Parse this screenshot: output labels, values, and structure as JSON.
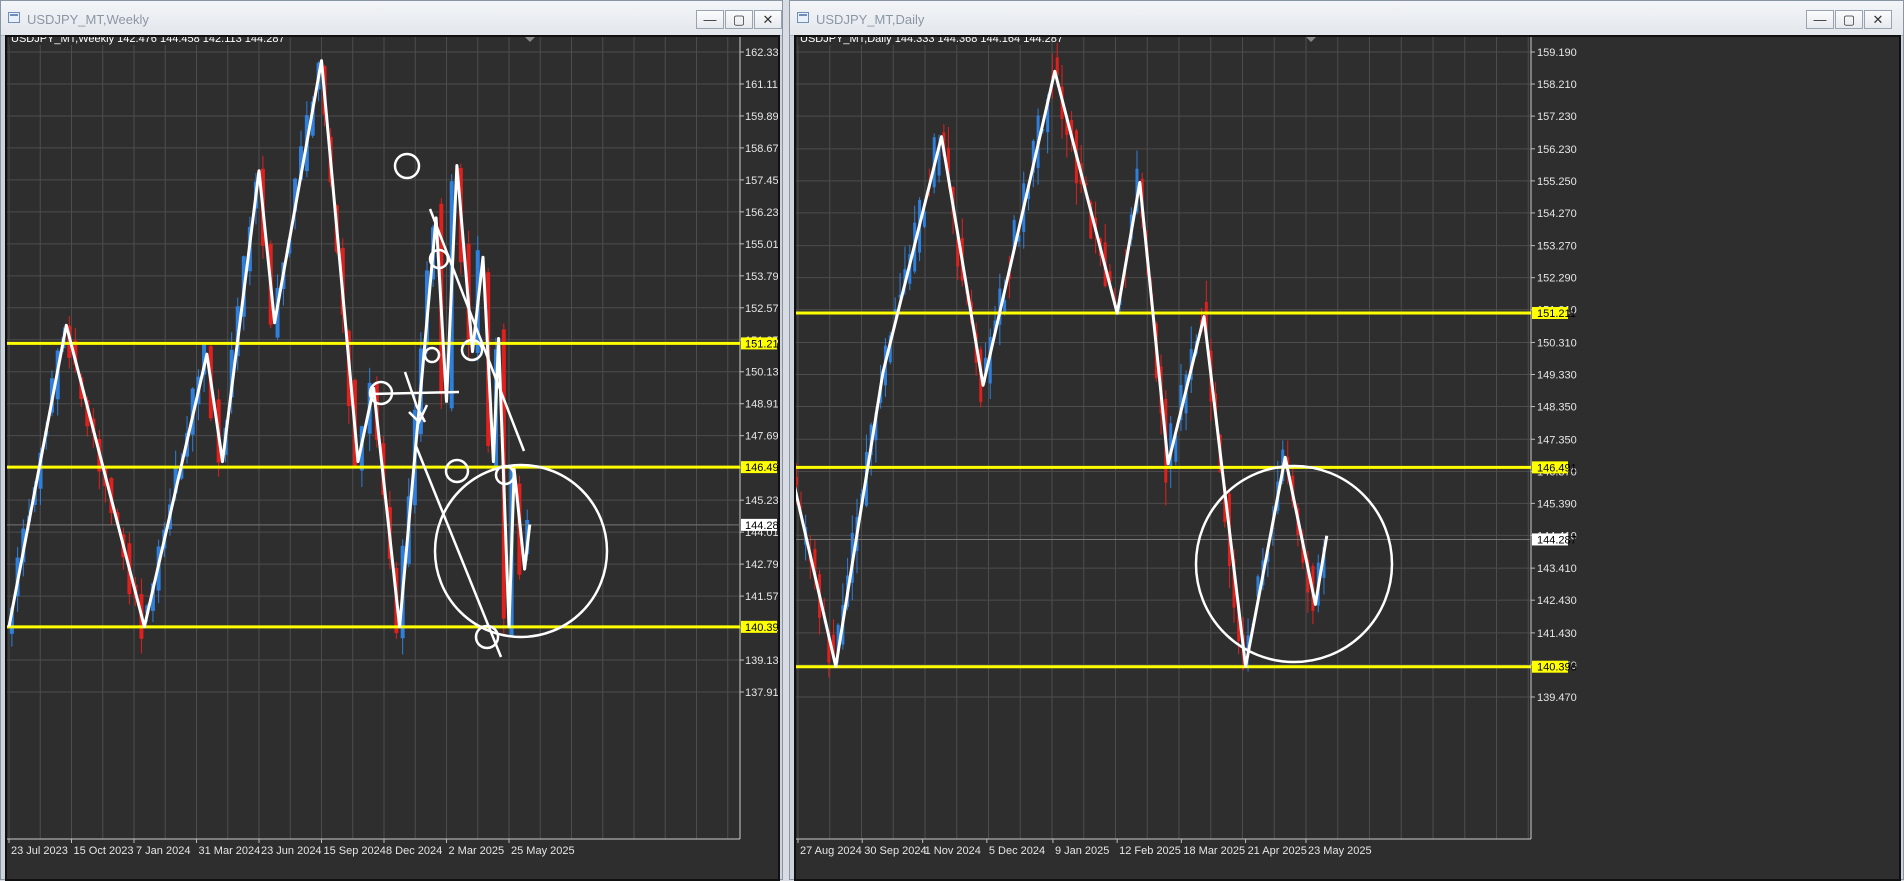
{
  "windows": [
    {
      "title": "USDJPY_MT,Weekly",
      "buttons": {
        "minimize": "—",
        "maximize": "▢",
        "close": "✕"
      }
    },
    {
      "title": "USDJPY_MT,Daily",
      "buttons": {
        "minimize": "—",
        "maximize": "▢",
        "close": "✕"
      }
    }
  ],
  "colors": {
    "background": "#2e2e2e",
    "grid": "#4d4d4d",
    "bull_candle": "#2f7fdc",
    "bear_candle": "#e0201c",
    "level_line": "#ffff00",
    "drawing": "#ffffff"
  },
  "chart_data": [
    {
      "type": "candlestick",
      "symbol": "USDJPY_MT",
      "timeframe": "Weekly",
      "ohlc_label": "142.476 144.458 142.113 144.287",
      "price_ticks": [
        "162.330",
        "161.110",
        "159.890",
        "158.670",
        "157.450",
        "156.230",
        "155.010",
        "153.790",
        "152.570",
        "151.350",
        "150.130",
        "148.910",
        "147.690",
        "146.470",
        "145.230",
        "144.010",
        "142.790",
        "141.570",
        "140.350",
        "139.130",
        "137.910"
      ],
      "date_ticks": [
        "23 Jul 2023",
        "15 Oct 2023",
        "7 Jan 2024",
        "31 Mar 2024",
        "23 Jun 2024",
        "15 Sep 2024",
        "8 Dec 2024",
        "2 Mar 2025",
        "25 May 2025"
      ],
      "ylim": [
        137.3,
        163.0
      ],
      "current_price": "144.287",
      "horizontal_levels": [
        "151.211",
        "146.491",
        "140.396"
      ],
      "zigzag_pivots": [
        {
          "date": "23 Jul 2023",
          "price": 140.4
        },
        {
          "date": "8 Oct 2023",
          "price": 151.9
        },
        {
          "date": "21 Jan 2024",
          "price": 140.4
        },
        {
          "date": "14 Apr 2024",
          "price": 150.8
        },
        {
          "date": "5 May 2024",
          "price": 146.7
        },
        {
          "date": "23 Jun 2024",
          "price": 157.8
        },
        {
          "date": "14 Jul 2024",
          "price": 152.0
        },
        {
          "date": "15 Sep 2024",
          "price": 162.0
        },
        {
          "date": "3 Nov 2024",
          "price": 146.7
        },
        {
          "date": "24 Nov 2024",
          "price": 149.5
        },
        {
          "date": "29 Dec 2024",
          "price": 140.4
        },
        {
          "date": "16 Feb 2025",
          "price": 156.0
        },
        {
          "date": "2 Mar 2025",
          "price": 149.0
        },
        {
          "date": "16 Mar 2025",
          "price": 158.0
        },
        {
          "date": "6 Apr 2025",
          "price": 150.9
        },
        {
          "date": "20 Apr 2025",
          "price": 154.5
        },
        {
          "date": "4 May 2025",
          "price": 146.7
        },
        {
          "date": "11 May 2025",
          "price": 151.4
        },
        {
          "date": "25 May 2025",
          "price": 140.4
        },
        {
          "date": "1 Jun 2025",
          "price": 146.4
        },
        {
          "date": "15 Jun 2025",
          "price": 142.6
        },
        {
          "date": "22 Jun 2025",
          "price": 144.3
        }
      ]
    },
    {
      "type": "candlestick",
      "symbol": "USDJPY_MT",
      "timeframe": "Daily",
      "ohlc_label": "144.333 144.368 144.164 144.287",
      "price_ticks": [
        "159.190",
        "158.210",
        "157.230",
        "156.230",
        "155.250",
        "154.270",
        "153.270",
        "152.290",
        "151.310",
        "150.310",
        "149.330",
        "148.350",
        "147.350",
        "146.370",
        "145.390",
        "144.410",
        "143.410",
        "142.430",
        "141.430",
        "140.450",
        "139.470"
      ],
      "date_ticks": [
        "27 Aug 2024",
        "30 Sep 2024",
        "1 Nov 2024",
        "5 Dec 2024",
        "9 Jan 2025",
        "12 Feb 2025",
        "18 Mar 2025",
        "21 Apr 2025",
        "23 May 2025"
      ],
      "ylim": [
        138.9,
        159.9
      ],
      "current_price": "144.287",
      "horizontal_levels": [
        "151.211",
        "146.491",
        "140.396"
      ],
      "zigzag_pivots": [
        {
          "date": "20 Aug 2024",
          "price": 147.2
        },
        {
          "date": "16 Sep 2024",
          "price": 140.4
        },
        {
          "date": "11 Oct 2024",
          "price": 149.4
        },
        {
          "date": "11 Nov 2024",
          "price": 156.6
        },
        {
          "date": "3 Dec 2024",
          "price": 149.0
        },
        {
          "date": "10 Jan 2025",
          "price": 158.6
        },
        {
          "date": "12 Feb 2025",
          "price": 151.2
        },
        {
          "date": "24 Feb 2025",
          "price": 155.2
        },
        {
          "date": "11 Mar 2025",
          "price": 146.6
        },
        {
          "date": "30 Mar 2025",
          "price": 151.1
        },
        {
          "date": "21 Apr 2025",
          "price": 140.4
        },
        {
          "date": "12 May 2025",
          "price": 146.8
        },
        {
          "date": "28 May 2025",
          "price": 142.3
        },
        {
          "date": "3 Jun 2025",
          "price": 144.4
        }
      ]
    }
  ]
}
